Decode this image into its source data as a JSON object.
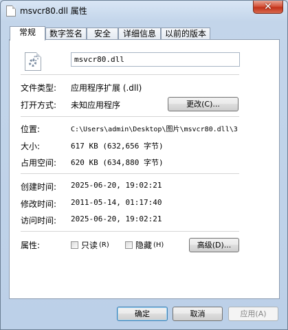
{
  "window": {
    "title": "msvcr80.dll 属性",
    "close_glyph": "✕"
  },
  "tabs": [
    "常规",
    "数字签名",
    "安全",
    "详细信息",
    "以前的版本"
  ],
  "general": {
    "file_name": "msvcr80.dll",
    "file_type_label": "文件类型:",
    "file_type_value": "应用程序扩展 (.dll)",
    "open_with_label": "打开方式:",
    "open_with_value": "未知应用程序",
    "change_button": "更改(C)...",
    "location_label": "位置:",
    "location_value": "C:\\Users\\admin\\Desktop\\图片\\msvcr80.dll\\3",
    "size_label": "大小:",
    "size_value": "617 KB (632,656 字节)",
    "size_on_disk_label": "占用空间:",
    "size_on_disk_value": "620 KB (634,880 字节)",
    "created_label": "创建时间:",
    "created_value": "2025-06-20, 19:02:21",
    "modified_label": "修改时间:",
    "modified_value": "2011-05-14, 01:17:40",
    "accessed_label": "访问时间:",
    "accessed_value": "2025-06-20, 19:02:21",
    "attributes_label": "属性:",
    "readonly_label": "只读",
    "readonly_hotkey": "(R)",
    "readonly_checked": false,
    "hidden_label": "隐藏",
    "hidden_hotkey": "(H)",
    "hidden_checked": false,
    "advanced_button": "高级(D)..."
  },
  "footer": {
    "ok": "确定",
    "cancel": "取消",
    "apply": "应用(A)"
  },
  "icons": {
    "title": "dll-file-icon",
    "file": "dll-gear-file-icon"
  }
}
